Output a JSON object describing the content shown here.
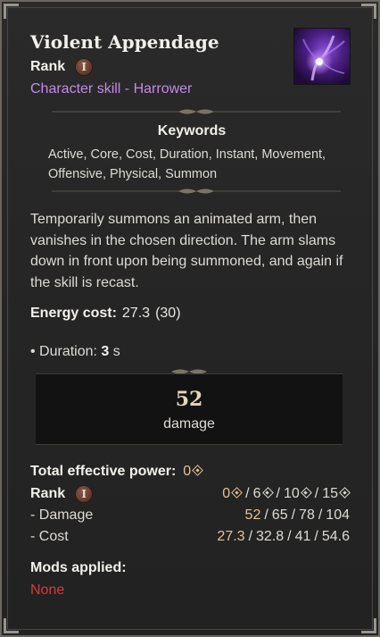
{
  "skill": {
    "name": "Violent Appendage",
    "rank_label": "Rank",
    "rank_numeral": "I",
    "type": "Character skill - Harrower",
    "icon": "purple-arm-skill-icon"
  },
  "keywords": {
    "title": "Keywords",
    "list": "Active, Core, Cost, Duration, Instant, Movement, Offensive, Physical, Summon"
  },
  "description": "Temporarily summons an animated arm, then vanishes in the chosen direction. The arm slams down in front upon being summoned, and again if the skill is recast.",
  "energy": {
    "label": "Energy cost:",
    "value": "27.3",
    "base": "(30)"
  },
  "duration": {
    "bullet": "• Duration:",
    "value": "3",
    "unit": "s"
  },
  "damage_box": {
    "value": "52",
    "label": "damage"
  },
  "power": {
    "label": "Total effective power:",
    "value": "0"
  },
  "rank_table": {
    "label": "Rank",
    "numeral": "I",
    "levels": [
      "0",
      "6",
      "10",
      "15"
    ],
    "rows": [
      {
        "label": "- Damage",
        "values": [
          "52",
          "65",
          "78",
          "104"
        ]
      },
      {
        "label": "- Cost",
        "values": [
          "27.3",
          "32.8",
          "41",
          "54.6"
        ]
      }
    ]
  },
  "mods": {
    "title": "Mods applied:",
    "value": "None"
  },
  "colors": {
    "skill_type": "#c48ae6",
    "gold": "#e2c48e",
    "none_red": "#d23a3a"
  }
}
